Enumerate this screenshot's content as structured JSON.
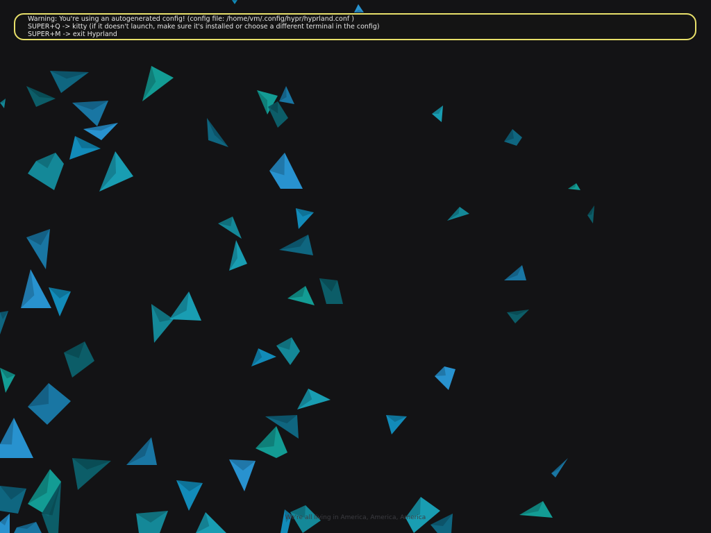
{
  "notification": {
    "lines": [
      "Warning: You're using an autogenerated config! (config file: /home/vm/.config/hypr/hyprland.conf )",
      "SUPER+Q -> kitty (if it doesn't launch, make sure it's installed or choose a different terminal in the config)",
      "SUPER+M -> exit Hyprland"
    ],
    "border_color": "#e8e06a"
  },
  "wallpaper": {
    "caption": "We're all living in America, America, America",
    "background_color": "#131315",
    "shard_colors": [
      "#13a8a0",
      "#1592a4",
      "#1a7fb0",
      "#0f6e8a",
      "#1296c8",
      "#0c6470",
      "#1aa9c0",
      "#2a9de0"
    ]
  }
}
